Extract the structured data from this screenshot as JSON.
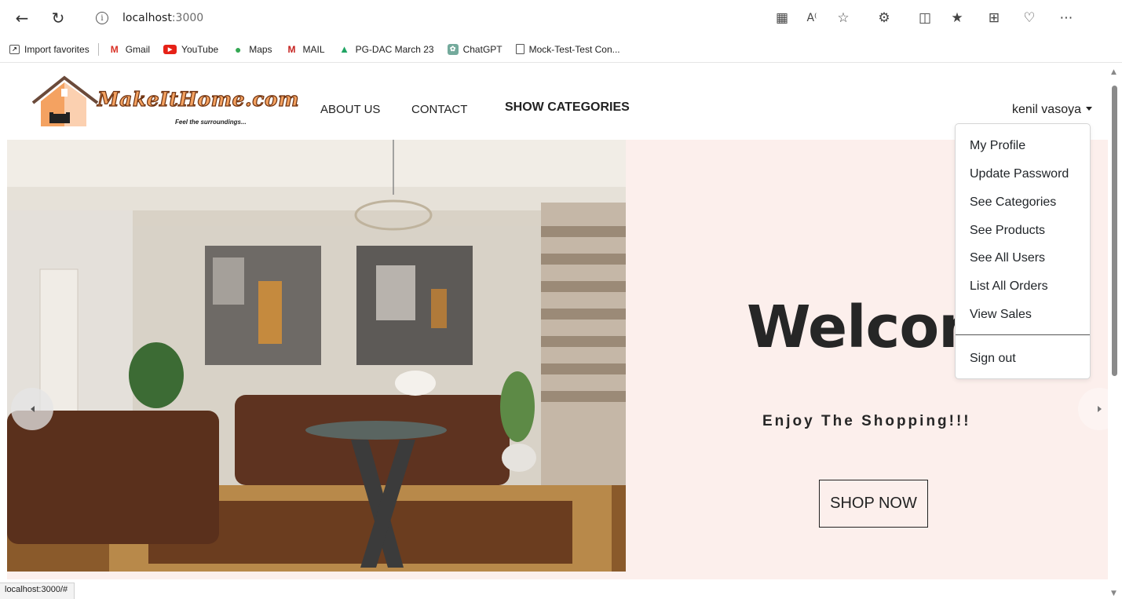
{
  "browser": {
    "url_host": "localhost",
    "url_port": ":3000",
    "status_url": "localhost:3000/#"
  },
  "bookmarks": [
    {
      "label": "Import favorites",
      "icon": "import-icon"
    },
    {
      "label": "Gmail",
      "icon": "gmail-icon"
    },
    {
      "label": "YouTube",
      "icon": "youtube-icon"
    },
    {
      "label": "Maps",
      "icon": "maps-icon"
    },
    {
      "label": "MAIL",
      "icon": "mail-icon"
    },
    {
      "label": "PG-DAC March 23",
      "icon": "drive-icon"
    },
    {
      "label": "ChatGPT",
      "icon": "chatgpt-icon"
    },
    {
      "label": "Mock-Test-Test Con...",
      "icon": "page-icon"
    }
  ],
  "site": {
    "logo_text": "MakeItHome.com",
    "logo_tagline": "Feel the surroundings...",
    "nav": {
      "about": "ABOUT US",
      "contact": "CONTACT",
      "categories": "SHOW CATEGORIES"
    },
    "user_name": "kenil vasoya"
  },
  "dropdown": {
    "items": [
      "My Profile",
      "Update Password",
      "See Categories",
      "See Products",
      "See All Users",
      "List All Orders",
      "View Sales"
    ],
    "signout": "Sign out"
  },
  "hero": {
    "welcome": "Welcome",
    "subtitle": "Enjoy The Shopping!!!",
    "cta": "SHOP NOW"
  },
  "colors": {
    "hero_bg": "#fcefec",
    "logo_fill": "#f4a261"
  }
}
